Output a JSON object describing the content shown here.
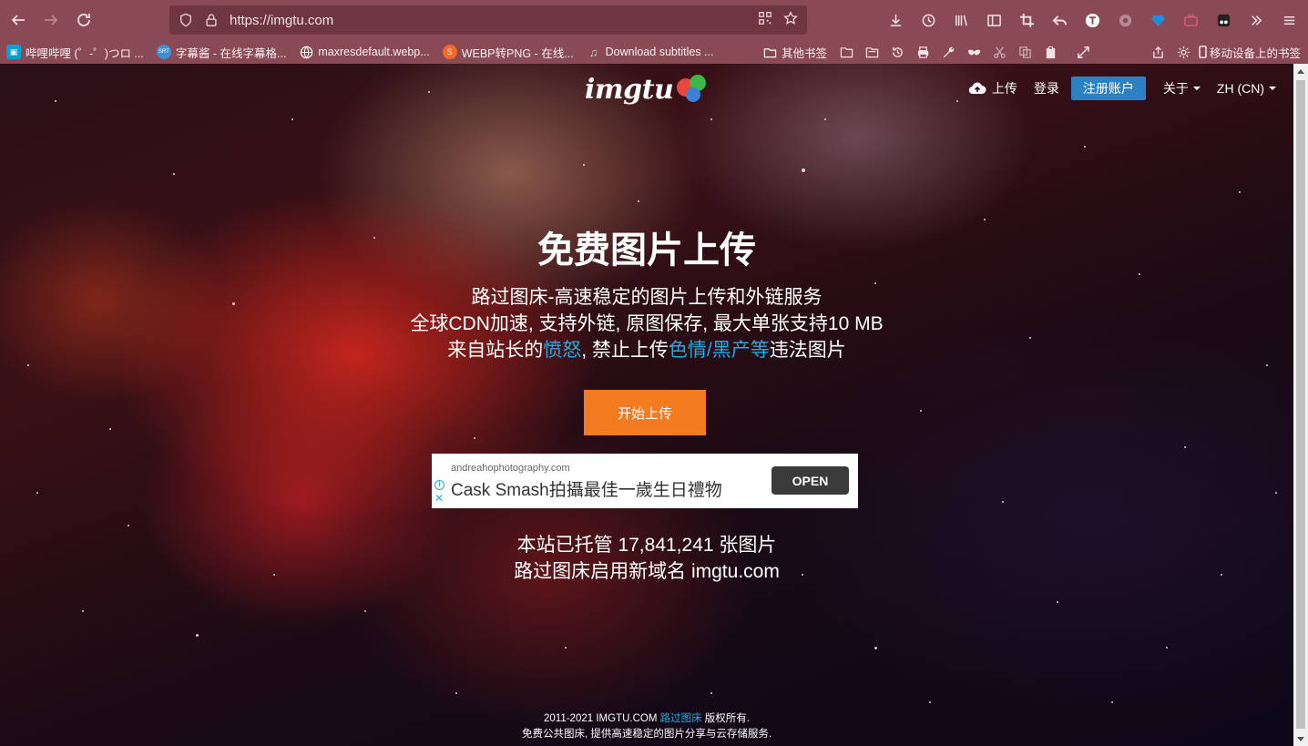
{
  "browser": {
    "url": "https://imgtu.com",
    "bookmarks": [
      {
        "label": "哔哩哔哩 (゜-゜)つロ ...",
        "icon": "bilibili-icon",
        "color": "#00a1d6"
      },
      {
        "label": "字幕酱 - 在线字幕格...",
        "icon": "srt-icon",
        "color": "#3a8fd6"
      },
      {
        "label": "maxresdefault.webp...",
        "icon": "globe-icon",
        "color": "#ffffff"
      },
      {
        "label": "WEBP转PNG - 在线...",
        "icon": "convert-icon",
        "color": "#f06a2a"
      },
      {
        "label": "Download subtitles ...",
        "icon": "subtitle-icon",
        "color": "#cccccc"
      }
    ],
    "other_bookmarks": "其他书签",
    "mobile_bookmarks": "移动设备上的书签"
  },
  "site": {
    "logo_text": "imgtu",
    "nav": {
      "upload": "上传",
      "login": "登录",
      "register": "注册账户",
      "about": "关于",
      "language": "ZH (CN)"
    },
    "hero": {
      "title": "免费图片上传",
      "line1": "路过图床-高速稳定的图片上传和外链服务",
      "line2": "全球CDN加速, 支持外链, 原图保存, 最大单张支持10 MB",
      "line3_prefix": "来自站长的",
      "line3_highlight1": "愤怒",
      "line3_mid": ", 禁止上传",
      "line3_highlight2": "色情/黑产等",
      "line3_suffix": "违法图片",
      "cta": "开始上传"
    },
    "ad": {
      "domain": "andreahophotography.com",
      "text": "Cask Smash拍攝最佳一歲生日禮物",
      "button": "OPEN"
    },
    "stats": {
      "hosted": "本站已托管 17,841,241 张图片",
      "domain_notice": "路过图床启用新域名 imgtu.com"
    },
    "footer": {
      "copyright_prefix": "2011-2021 IMGTU.COM ",
      "copyright_link": "路过图床",
      "copyright_suffix": " 版权所有.",
      "tagline": "免费公共图床, 提供高速稳定的图片分享与云存储服务."
    }
  },
  "colors": {
    "accent_blue": "#29a8e0",
    "cta_orange": "#f47b1f",
    "register_blue": "#2a81c4",
    "browser_chrome": "#8a4a55"
  }
}
